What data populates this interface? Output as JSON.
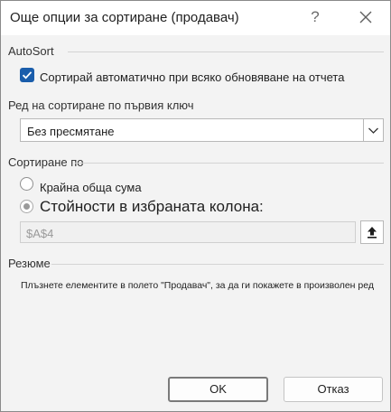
{
  "dialog": {
    "title": "Още опции за сортиране (продавач)",
    "help_label": "?"
  },
  "autosort": {
    "section_label": "AutoSort",
    "checkbox_label": "Сортирай автоматично при всяко обновяване на отчета",
    "checked": true
  },
  "first_key": {
    "section_label": "Ред на сортиране по първия ключ",
    "selected_value": "Без пресмятане"
  },
  "sort_by": {
    "section_label": "Сортиране по",
    "option_grand_total": "Крайна обща сума",
    "option_selected_column": "Стойности в избраната колона:",
    "selected_option": "option_selected_column",
    "reference_value": "$A$4"
  },
  "summary": {
    "section_label": "Резюме",
    "text": "Плъзнете елементите в полето \"Продавач\", за да ги покажете в произволен ред"
  },
  "buttons": {
    "ok_label": "OK",
    "cancel_label": "Отказ"
  },
  "colors": {
    "accent": "#1a5dab",
    "dialog_background": "#f3f3f3"
  }
}
